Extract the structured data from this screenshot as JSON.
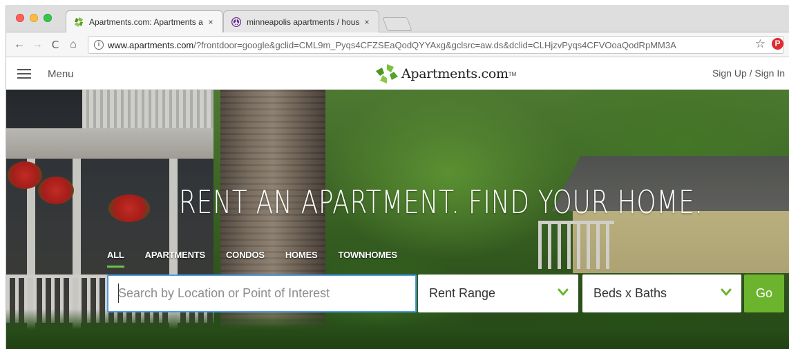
{
  "browser": {
    "tabs": [
      {
        "title": "Apartments.com: Apartments a",
        "icon": "apartments-favicon-icon",
        "close": "×",
        "active": true
      },
      {
        "title": "minneapolis apartments / hous",
        "icon": "craigslist-peace-icon",
        "close": "×",
        "active": false
      }
    ],
    "url_domain": "www.apartments.com",
    "url_path": "/?frontdoor=google&gclid=CML9m_Pyqs4CFZSEaQodQYYAxg&gclsrc=aw.ds&dclid=CLHjzvPyqs4CFVOoaQodRpMM3A",
    "nav": {
      "back": "←",
      "forward": "→",
      "reload": "C",
      "home": "⌂",
      "info": "i"
    },
    "star": "☆",
    "pinterest": "P"
  },
  "site": {
    "menu_label": "Menu",
    "logo_text": "Apartments.com",
    "logo_tm": "TM",
    "signin": "Sign Up / Sign In"
  },
  "hero": {
    "headline": "RENT AN APARTMENT. FIND YOUR HOME.",
    "tabs": [
      "ALL",
      "APARTMENTS",
      "CONDOS",
      "HOMES",
      "TOWNHOMES"
    ],
    "active_tab": "ALL",
    "search_placeholder": "Search by Location or Point of Interest",
    "search_value": "",
    "rent_range_label": "Rent Range",
    "beds_baths_label": "Beds x Baths",
    "go_label": "Go"
  },
  "colors": {
    "accent_green": "#6cb42e",
    "tab_underline": "#6cc04a",
    "input_focus": "#4c9be8"
  }
}
